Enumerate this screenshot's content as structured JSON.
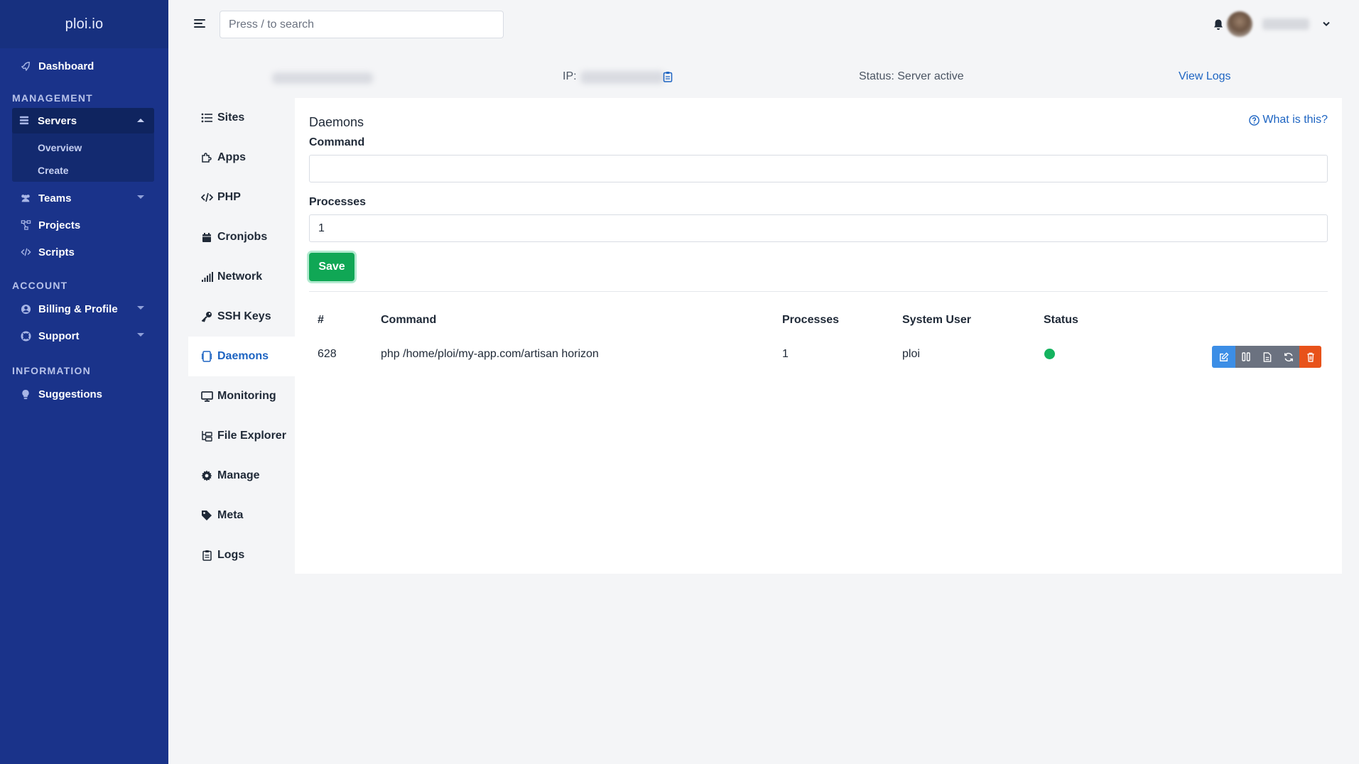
{
  "brand": "ploi.io",
  "sidebar": {
    "dashboard": "Dashboard",
    "sections": {
      "management": "MANAGEMENT",
      "account": "ACCOUNT",
      "information": "INFORMATION"
    },
    "servers": {
      "label": "Servers",
      "children": [
        "Overview",
        "Create"
      ]
    },
    "teams": "Teams",
    "projects": "Projects",
    "scripts": "Scripts",
    "billing": "Billing & Profile",
    "support": "Support",
    "suggestions": "Suggestions"
  },
  "topbar": {
    "search_placeholder": "Press / to search"
  },
  "server_info": {
    "ip_label": "IP:",
    "status": "Status: Server active",
    "view_logs": "View Logs"
  },
  "server_nav": [
    {
      "label": "Sites",
      "icon": "list-icon"
    },
    {
      "label": "Apps",
      "icon": "puzzle-icon"
    },
    {
      "label": "PHP",
      "icon": "code-icon"
    },
    {
      "label": "Cronjobs",
      "icon": "calendar-icon"
    },
    {
      "label": "Network",
      "icon": "signal-icon"
    },
    {
      "label": "SSH Keys",
      "icon": "key-icon"
    },
    {
      "label": "Daemons",
      "icon": "daemon-icon",
      "active": true
    },
    {
      "label": "Monitoring",
      "icon": "monitor-icon"
    },
    {
      "label": "File Explorer",
      "icon": "folder-tree-icon"
    },
    {
      "label": "Manage",
      "icon": "gear-icon"
    },
    {
      "label": "Meta",
      "icon": "tag-icon"
    },
    {
      "label": "Logs",
      "icon": "clipboard-icon"
    }
  ],
  "daemons": {
    "title": "Daemons",
    "help_link": "What is this?",
    "command_label": "Command",
    "command_value": "",
    "processes_label": "Processes",
    "processes_value": "1",
    "save_label": "Save",
    "table": {
      "headers": [
        "#",
        "Command",
        "Processes",
        "System User",
        "Status"
      ],
      "rows": [
        {
          "id": "628",
          "command": "php /home/ploi/my-app.com/artisan horizon",
          "processes": "1",
          "user": "ploi",
          "status": "active",
          "status_color": "#14b35f"
        }
      ]
    }
  },
  "colors": {
    "sidebar": "#1a338a",
    "accent": "#1d64c2",
    "save": "#10a755",
    "delete": "#e8521a"
  }
}
